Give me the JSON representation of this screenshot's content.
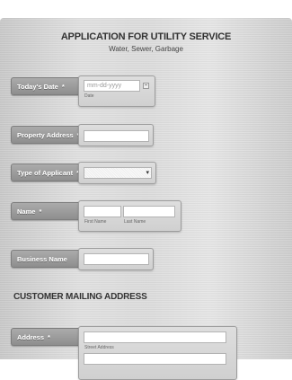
{
  "form": {
    "title": "APPLICATION FOR UTILITY SERVICE",
    "subtitle": "Water, Sewer, Garbage"
  },
  "fields": {
    "todays_date": {
      "label": "Today's Date",
      "required_mark": "*",
      "placeholder": "mm-dd-yyyy",
      "sublabel": "Date"
    },
    "property_address": {
      "label": "Property Address",
      "required_mark": "*",
      "value": ""
    },
    "type_of_applicant": {
      "label": "Type of Applicant",
      "required_mark": "*",
      "selected": ""
    },
    "name": {
      "label": "Name",
      "required_mark": "*",
      "first_sublabel": "First Name",
      "last_sublabel": "Last Name"
    },
    "business_name": {
      "label": "Business Name",
      "value": ""
    }
  },
  "mailing": {
    "section_title": "CUSTOMER MAILING ADDRESS",
    "address": {
      "label": "Address",
      "required_mark": "*",
      "sublabel": "Street Address"
    }
  },
  "icons": {
    "calendar": "calendar-icon",
    "dropdown": "chevron-down-icon"
  }
}
